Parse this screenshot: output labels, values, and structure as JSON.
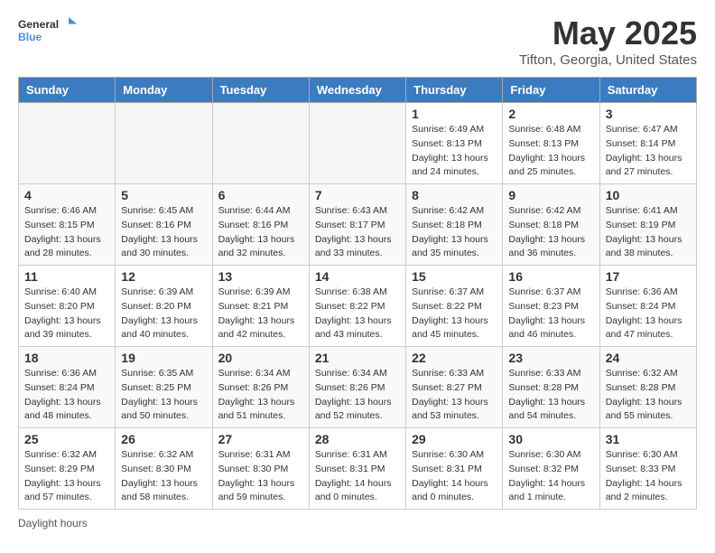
{
  "logo": {
    "line1": "General",
    "line2": "Blue"
  },
  "title": "May 2025",
  "location": "Tifton, Georgia, United States",
  "days_header": [
    "Sunday",
    "Monday",
    "Tuesday",
    "Wednesday",
    "Thursday",
    "Friday",
    "Saturday"
  ],
  "weeks": [
    [
      {
        "num": "",
        "info": ""
      },
      {
        "num": "",
        "info": ""
      },
      {
        "num": "",
        "info": ""
      },
      {
        "num": "",
        "info": ""
      },
      {
        "num": "1",
        "info": "Sunrise: 6:49 AM\nSunset: 8:13 PM\nDaylight: 13 hours\nand 24 minutes."
      },
      {
        "num": "2",
        "info": "Sunrise: 6:48 AM\nSunset: 8:13 PM\nDaylight: 13 hours\nand 25 minutes."
      },
      {
        "num": "3",
        "info": "Sunrise: 6:47 AM\nSunset: 8:14 PM\nDaylight: 13 hours\nand 27 minutes."
      }
    ],
    [
      {
        "num": "4",
        "info": "Sunrise: 6:46 AM\nSunset: 8:15 PM\nDaylight: 13 hours\nand 28 minutes."
      },
      {
        "num": "5",
        "info": "Sunrise: 6:45 AM\nSunset: 8:16 PM\nDaylight: 13 hours\nand 30 minutes."
      },
      {
        "num": "6",
        "info": "Sunrise: 6:44 AM\nSunset: 8:16 PM\nDaylight: 13 hours\nand 32 minutes."
      },
      {
        "num": "7",
        "info": "Sunrise: 6:43 AM\nSunset: 8:17 PM\nDaylight: 13 hours\nand 33 minutes."
      },
      {
        "num": "8",
        "info": "Sunrise: 6:42 AM\nSunset: 8:18 PM\nDaylight: 13 hours\nand 35 minutes."
      },
      {
        "num": "9",
        "info": "Sunrise: 6:42 AM\nSunset: 8:18 PM\nDaylight: 13 hours\nand 36 minutes."
      },
      {
        "num": "10",
        "info": "Sunrise: 6:41 AM\nSunset: 8:19 PM\nDaylight: 13 hours\nand 38 minutes."
      }
    ],
    [
      {
        "num": "11",
        "info": "Sunrise: 6:40 AM\nSunset: 8:20 PM\nDaylight: 13 hours\nand 39 minutes."
      },
      {
        "num": "12",
        "info": "Sunrise: 6:39 AM\nSunset: 8:20 PM\nDaylight: 13 hours\nand 40 minutes."
      },
      {
        "num": "13",
        "info": "Sunrise: 6:39 AM\nSunset: 8:21 PM\nDaylight: 13 hours\nand 42 minutes."
      },
      {
        "num": "14",
        "info": "Sunrise: 6:38 AM\nSunset: 8:22 PM\nDaylight: 13 hours\nand 43 minutes."
      },
      {
        "num": "15",
        "info": "Sunrise: 6:37 AM\nSunset: 8:22 PM\nDaylight: 13 hours\nand 45 minutes."
      },
      {
        "num": "16",
        "info": "Sunrise: 6:37 AM\nSunset: 8:23 PM\nDaylight: 13 hours\nand 46 minutes."
      },
      {
        "num": "17",
        "info": "Sunrise: 6:36 AM\nSunset: 8:24 PM\nDaylight: 13 hours\nand 47 minutes."
      }
    ],
    [
      {
        "num": "18",
        "info": "Sunrise: 6:36 AM\nSunset: 8:24 PM\nDaylight: 13 hours\nand 48 minutes."
      },
      {
        "num": "19",
        "info": "Sunrise: 6:35 AM\nSunset: 8:25 PM\nDaylight: 13 hours\nand 50 minutes."
      },
      {
        "num": "20",
        "info": "Sunrise: 6:34 AM\nSunset: 8:26 PM\nDaylight: 13 hours\nand 51 minutes."
      },
      {
        "num": "21",
        "info": "Sunrise: 6:34 AM\nSunset: 8:26 PM\nDaylight: 13 hours\nand 52 minutes."
      },
      {
        "num": "22",
        "info": "Sunrise: 6:33 AM\nSunset: 8:27 PM\nDaylight: 13 hours\nand 53 minutes."
      },
      {
        "num": "23",
        "info": "Sunrise: 6:33 AM\nSunset: 8:28 PM\nDaylight: 13 hours\nand 54 minutes."
      },
      {
        "num": "24",
        "info": "Sunrise: 6:32 AM\nSunset: 8:28 PM\nDaylight: 13 hours\nand 55 minutes."
      }
    ],
    [
      {
        "num": "25",
        "info": "Sunrise: 6:32 AM\nSunset: 8:29 PM\nDaylight: 13 hours\nand 57 minutes."
      },
      {
        "num": "26",
        "info": "Sunrise: 6:32 AM\nSunset: 8:30 PM\nDaylight: 13 hours\nand 58 minutes."
      },
      {
        "num": "27",
        "info": "Sunrise: 6:31 AM\nSunset: 8:30 PM\nDaylight: 13 hours\nand 59 minutes."
      },
      {
        "num": "28",
        "info": "Sunrise: 6:31 AM\nSunset: 8:31 PM\nDaylight: 14 hours\nand 0 minutes."
      },
      {
        "num": "29",
        "info": "Sunrise: 6:30 AM\nSunset: 8:31 PM\nDaylight: 14 hours\nand 0 minutes."
      },
      {
        "num": "30",
        "info": "Sunrise: 6:30 AM\nSunset: 8:32 PM\nDaylight: 14 hours\nand 1 minute."
      },
      {
        "num": "31",
        "info": "Sunrise: 6:30 AM\nSunset: 8:33 PM\nDaylight: 14 hours\nand 2 minutes."
      }
    ]
  ],
  "legend_label": "Daylight hours"
}
